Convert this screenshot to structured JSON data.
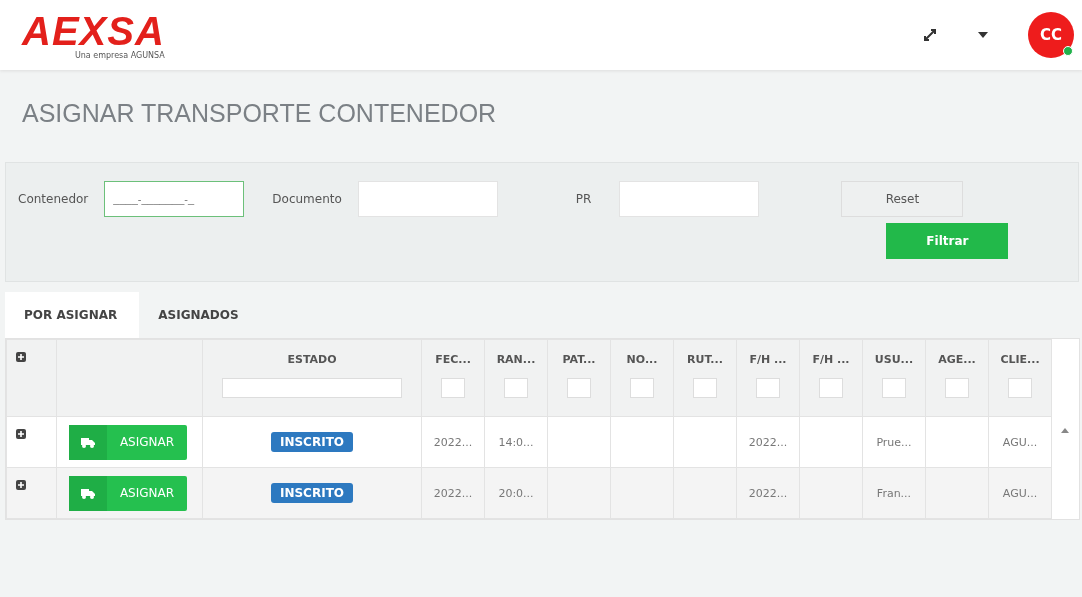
{
  "header": {
    "logo": "AEXSA",
    "logo_tagline": "Una empresa AGUNSA",
    "avatar": "CC",
    "online": true
  },
  "page_title": "ASIGNAR TRANSPORTE CONTENEDOR",
  "filters": {
    "fields": [
      {
        "label": "Contenedor",
        "placeholder": "____-_______-_",
        "focused": true
      },
      {
        "label": "Documento",
        "focused": false
      },
      {
        "label": "PR",
        "focused": false
      }
    ],
    "reset": "Reset",
    "apply": "Filtrar"
  },
  "tabs": [
    {
      "label": "POR ASIGNAR",
      "selected": true
    },
    {
      "label": "ASIGNADOS",
      "selected": false
    }
  ],
  "table": {
    "columns": [
      "ESTADO",
      "FEC...",
      "RAN...",
      "PAT...",
      "NO...",
      "RUT...",
      "F/H ...",
      "F/H ...",
      "USU...",
      "AGE...",
      "CLIE..."
    ],
    "rows": [
      {
        "action": "ASIGNAR",
        "cells": [
          "INSCRITO",
          "2022...",
          "14:0...",
          "",
          "",
          "",
          "2022...",
          "",
          "Prue...",
          "",
          "AGU..."
        ]
      },
      {
        "action": "ASIGNAR",
        "cells": [
          "INSCRITO",
          "2022...",
          "20:0...",
          "",
          "",
          "",
          "2022...",
          "",
          "Fran...",
          "",
          "AGU..."
        ]
      }
    ]
  }
}
